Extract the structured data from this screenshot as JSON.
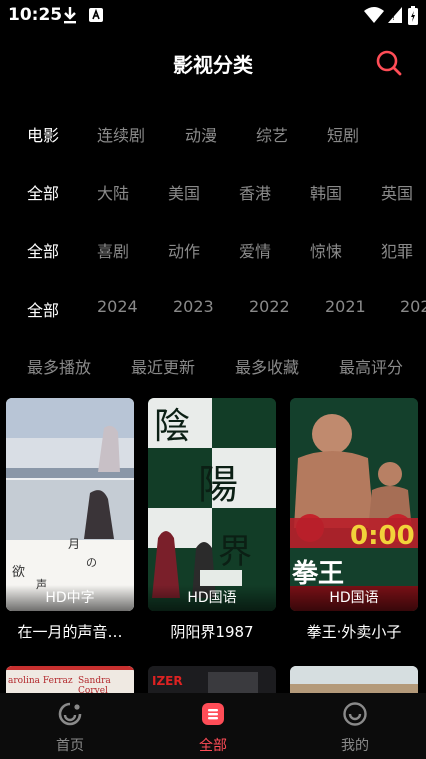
{
  "status": {
    "time": "10:25"
  },
  "header": {
    "title": "影视分类"
  },
  "filters": {
    "type": [
      "电影",
      "连续剧",
      "动漫",
      "综艺",
      "短剧"
    ],
    "region": [
      "全部",
      "大陆",
      "美国",
      "香港",
      "韩国",
      "英国"
    ],
    "genre": [
      "全部",
      "喜剧",
      "动作",
      "爱情",
      "惊悚",
      "犯罪"
    ],
    "year": [
      "全部",
      "2024",
      "2023",
      "2022",
      "2021",
      "202"
    ],
    "sort": [
      "最多播放",
      "最近更新",
      "最多收藏",
      "最高评分"
    ]
  },
  "cards": [
    {
      "title": "在一月的声音…",
      "badge": "HD中字"
    },
    {
      "title": "阴阳界1987",
      "badge": "HD国语"
    },
    {
      "title": "拳王·外卖小子",
      "badge": "HD国语"
    }
  ],
  "row2_posters": [
    {
      "text_left": "arolina Ferraz",
      "text_right": "Sandra Corvel"
    },
    {
      "text_left": "IZER"
    },
    {
      "text_left": ""
    }
  ],
  "tabbar": {
    "home": "首页",
    "all": "全部",
    "mine": "我的"
  },
  "colors": {
    "accent": "#ff4d57",
    "inactive": "#8a8a8a",
    "background": "#000000"
  }
}
